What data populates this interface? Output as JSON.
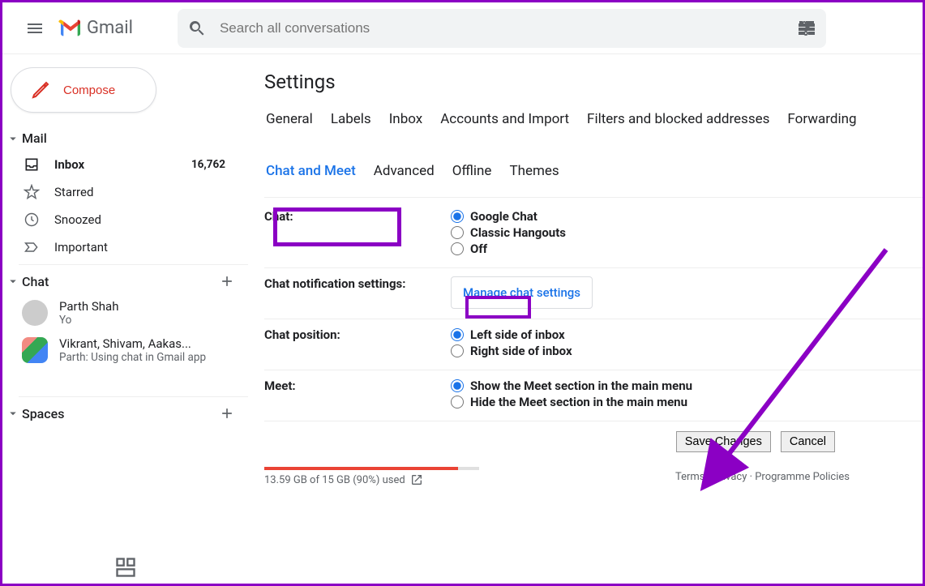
{
  "header": {
    "logo_text": "Gmail",
    "search_placeholder": "Search all conversations"
  },
  "sidebar": {
    "compose_label": "Compose",
    "sections": {
      "mail": {
        "title": "Mail",
        "items": [
          {
            "label": "Inbox",
            "count": "16,762"
          },
          {
            "label": "Starred"
          },
          {
            "label": "Snoozed"
          },
          {
            "label": "Important"
          }
        ]
      },
      "chat": {
        "title": "Chat",
        "items": [
          {
            "name": "Parth Shah",
            "message": "Yo"
          },
          {
            "name": "Vikrant, Shivam, Aakas...",
            "message": "Parth: Using chat in Gmail app"
          }
        ]
      },
      "spaces": {
        "title": "Spaces"
      }
    }
  },
  "settings": {
    "page_title": "Settings",
    "tabs_row1": [
      "General",
      "Labels",
      "Inbox",
      "Accounts and Import",
      "Filters and blocked addresses",
      "Forwarding"
    ],
    "tabs_row2": [
      "Chat and Meet",
      "Advanced",
      "Offline",
      "Themes"
    ],
    "selected_tab": "Chat and Meet",
    "rows": {
      "chat": {
        "label": "Chat:",
        "options": [
          "Google Chat",
          "Classic Hangouts",
          "Off"
        ],
        "selected": "Google Chat"
      },
      "notif": {
        "label": "Chat notification settings:",
        "button": "Manage chat settings"
      },
      "position": {
        "label": "Chat position:",
        "options": [
          "Left side of inbox",
          "Right side of inbox"
        ],
        "selected": "Left side of inbox"
      },
      "meet": {
        "label": "Meet:",
        "options": [
          "Show the Meet section in the main menu",
          "Hide the Meet section in the main menu"
        ],
        "selected": "Show the Meet section in the main menu"
      }
    },
    "actions": {
      "save": "Save Changes",
      "cancel": "Cancel"
    }
  },
  "footer": {
    "storage_pct": 90,
    "storage_text": "13.59 GB of 15 GB (90%) used",
    "links": [
      "Terms",
      "Privacy",
      "Programme Policies"
    ]
  }
}
